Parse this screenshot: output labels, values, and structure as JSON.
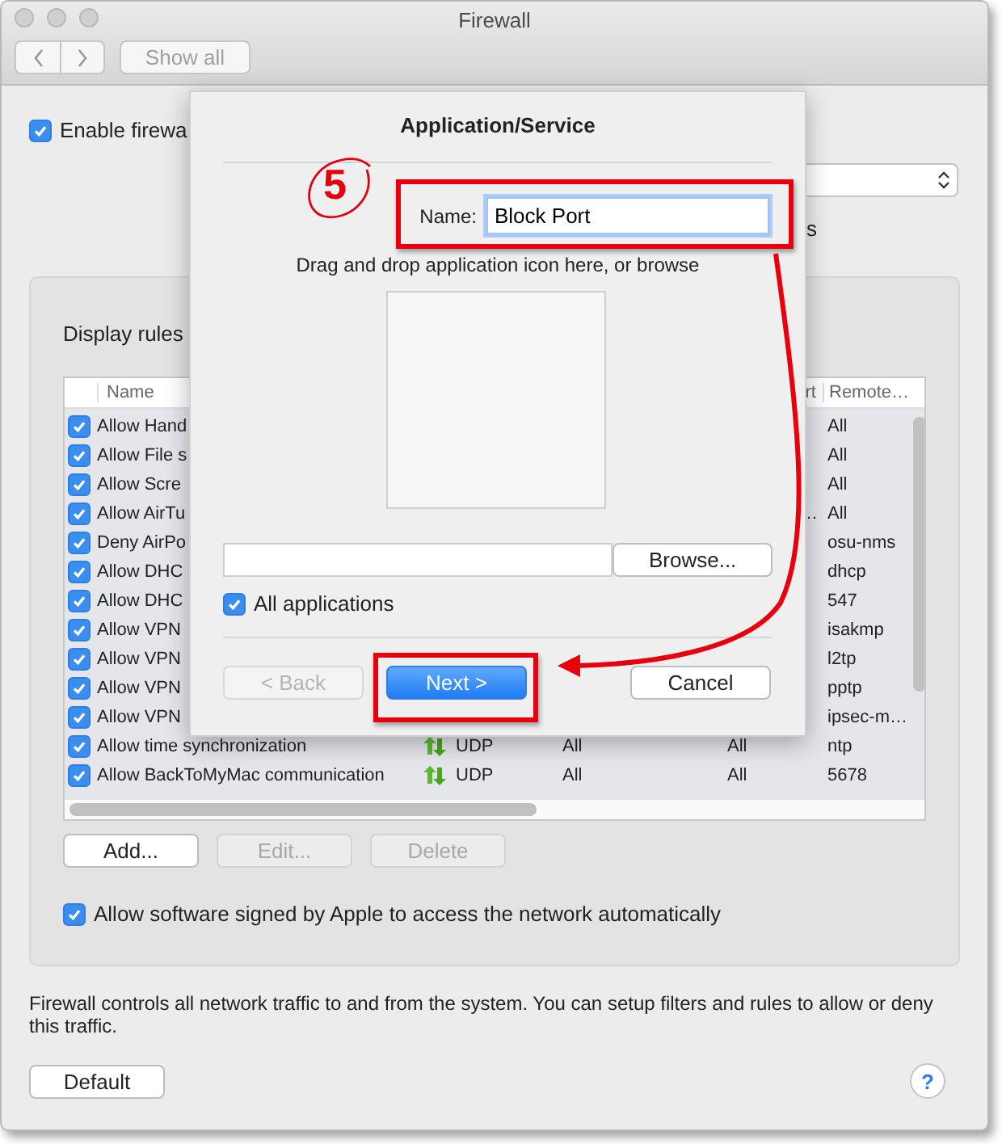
{
  "window": {
    "title": "Firewall"
  },
  "toolbar": {
    "show_all": "Show all"
  },
  "enable_firewall": {
    "label": "Enable firewa",
    "checked": true
  },
  "right_fragment": "s",
  "rules_panel": {
    "label": "Display rules",
    "columns": [
      "Name",
      "rt",
      "Remote…"
    ],
    "rows": [
      {
        "checked": true,
        "name": "Allow Hand",
        "remote": "All"
      },
      {
        "checked": true,
        "name": "Allow File s",
        "remote": "All"
      },
      {
        "checked": true,
        "name": "Allow Scre",
        "remote": "All"
      },
      {
        "checked": true,
        "name": "Allow AirTu",
        "column_4": "…",
        "remote": "All"
      },
      {
        "checked": true,
        "name": "Deny AirPo",
        "remote": "osu-nms"
      },
      {
        "checked": true,
        "name": "Allow DHC",
        "remote": "dhcp"
      },
      {
        "checked": true,
        "name": "Allow DHC",
        "remote": "547"
      },
      {
        "checked": true,
        "name": "Allow VPN",
        "remote": "isakmp"
      },
      {
        "checked": true,
        "name": "Allow VPN",
        "remote": "l2tp"
      },
      {
        "checked": true,
        "name": "Allow VPN",
        "remote": "pptp"
      },
      {
        "checked": true,
        "name": "Allow VPN",
        "remote": "ipsec-m…"
      },
      {
        "checked": true,
        "name": "Allow time synchronization",
        "column_2": "UDP",
        "column_3": "All",
        "column_4": "All",
        "remote": "ntp"
      },
      {
        "checked": true,
        "name": "Allow BackToMyMac communication",
        "column_2": "UDP",
        "column_3": "All",
        "column_4": "All",
        "remote": "5678"
      }
    ],
    "buttons": [
      {
        "label": "Add...",
        "disabled": false
      },
      {
        "label": "Edit...",
        "disabled": true
      },
      {
        "label": "Delete",
        "disabled": true
      }
    ],
    "allow_signed": {
      "label": "Allow software signed by Apple to access the network automatically",
      "checked": true
    }
  },
  "footer_text": "Firewall controls all network traffic to and from the system. You can setup filters and rules to allow or deny this traffic.",
  "default_button": "Default",
  "help": "?",
  "dialog": {
    "title": "Application/Service",
    "name_label": "Name:",
    "name_value": "Block Port",
    "hint": "Drag and drop application icon here, or browse",
    "browse": "Browse...",
    "all_applications": {
      "label": "All applications",
      "checked": true
    },
    "buttons": [
      {
        "label": "< Back",
        "kind": "disabled"
      },
      {
        "label": "Next >",
        "kind": "default"
      },
      {
        "label": "Cancel",
        "kind": "normal"
      }
    ]
  },
  "annotations": {
    "step": "5"
  }
}
